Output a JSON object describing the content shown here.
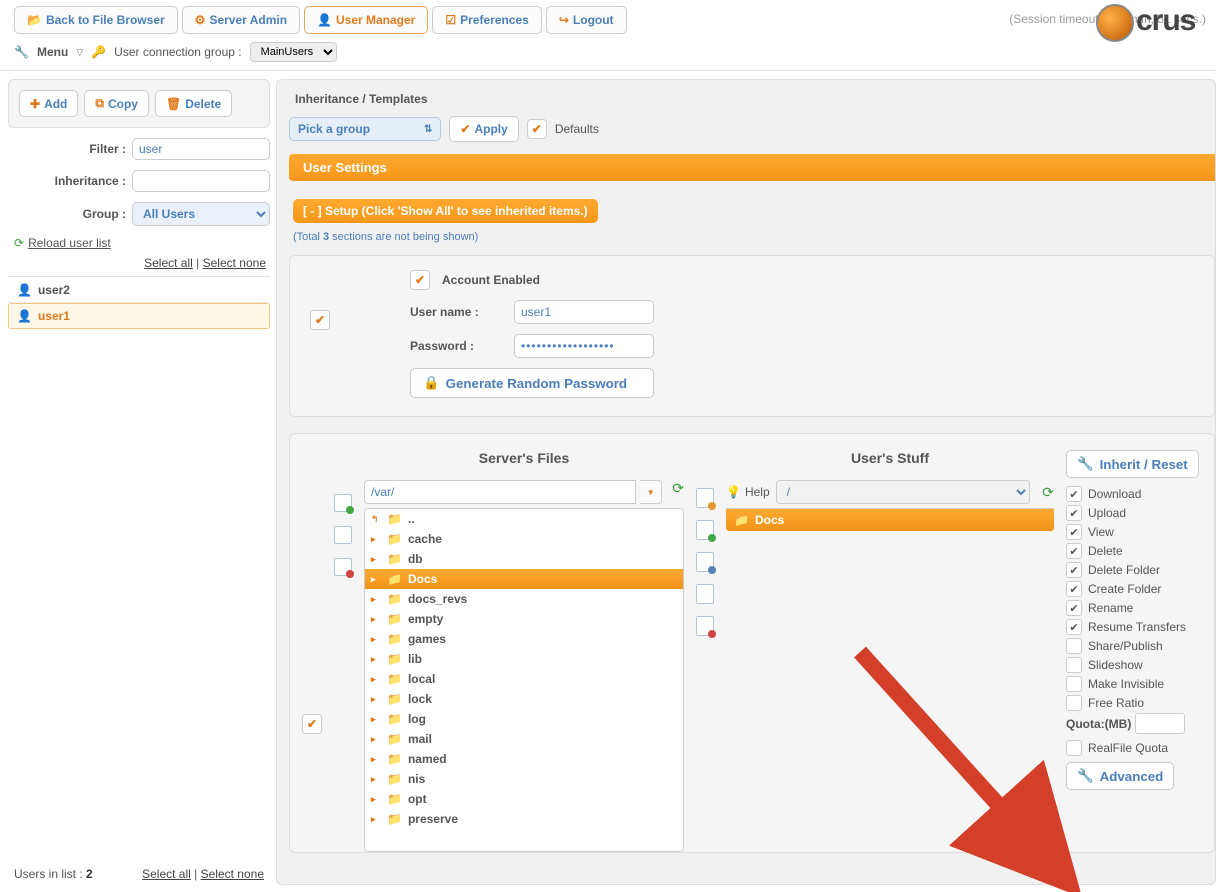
{
  "nav": {
    "back": "Back to File Browser",
    "server_admin": "Server Admin",
    "user_manager": "User Manager",
    "preferences": "Preferences",
    "logout": "Logout"
  },
  "session": "(Session timeout in 59 min, 51 secs.)",
  "logo": "crus",
  "subbar": {
    "menu": "Menu",
    "group_label": "User connection group :",
    "group_value": "MainUsers"
  },
  "left": {
    "add": "Add",
    "copy": "Copy",
    "delete": "Delete",
    "filter_label": "Filter :",
    "filter_value": "user",
    "inheritance_label": "Inheritance :",
    "inheritance_value": "",
    "group_label": "Group :",
    "group_value": "All Users",
    "reload": "Reload user list",
    "select_all": "Select all",
    "select_none": "Select none",
    "users": [
      {
        "name": "user2",
        "selected": false
      },
      {
        "name": "user1",
        "selected": true
      }
    ],
    "footer_label": "Users in list :",
    "footer_count": "2"
  },
  "right": {
    "inherit_label": "Inheritance / Templates",
    "pick_group": "Pick a group",
    "apply": "Apply",
    "defaults": "Defaults",
    "user_settings": "User Settings",
    "setup_toggle": "[ - ] Setup (Click 'Show All' to see inherited items.)",
    "hidden_pre": "(Total ",
    "hidden_count": "3",
    "hidden_post": " sections are not being shown)",
    "account_enabled": "Account Enabled",
    "username_label": "User name :",
    "username_value": "user1",
    "password_label": "Password :",
    "password_value": "••••••••••••••••••",
    "gen_password": "Generate Random Password",
    "servers_files": "Server's Files",
    "users_stuff": "User's Stuff",
    "path": "/var/",
    "help": "Help",
    "stuff_path": "/",
    "inherit_reset": "Inherit / Reset",
    "tree": [
      {
        "name": "..",
        "up": true
      },
      {
        "name": "cache"
      },
      {
        "name": "db"
      },
      {
        "name": "Docs",
        "selected": true
      },
      {
        "name": "docs_revs"
      },
      {
        "name": "empty"
      },
      {
        "name": "games"
      },
      {
        "name": "lib"
      },
      {
        "name": "local"
      },
      {
        "name": "lock"
      },
      {
        "name": "log"
      },
      {
        "name": "mail"
      },
      {
        "name": "named"
      },
      {
        "name": "nis"
      },
      {
        "name": "opt"
      },
      {
        "name": "preserve"
      }
    ],
    "stuff_item": "Docs",
    "perms": [
      {
        "label": "Download",
        "on": true
      },
      {
        "label": "Upload",
        "on": true
      },
      {
        "label": "View",
        "on": true
      },
      {
        "label": "Delete",
        "on": true
      },
      {
        "label": "Delete Folder",
        "on": true
      },
      {
        "label": "Create Folder",
        "on": true
      },
      {
        "label": "Rename",
        "on": true
      },
      {
        "label": "Resume Transfers",
        "on": true
      },
      {
        "label": "Share/Publish",
        "on": false
      },
      {
        "label": "Slideshow",
        "on": false
      },
      {
        "label": "Make Invisible",
        "on": false
      },
      {
        "label": "Free Ratio",
        "on": false
      }
    ],
    "quota_label": "Quota:(MB)",
    "realfile_quota": "RealFile Quota",
    "advanced": "Advanced"
  }
}
